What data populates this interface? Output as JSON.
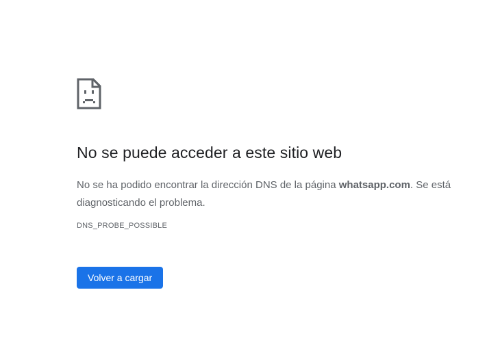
{
  "error_page": {
    "icon": "sad-page-icon",
    "headline": "No se puede acceder a este sitio web",
    "message_prefix": "No se ha podido encontrar la dirección DNS de la página ",
    "message_domain": "whatsapp.com",
    "message_suffix": ". Se está diagnosticando el problema.",
    "error_code": "DNS_PROBE_POSSIBLE",
    "reload_label": "Volver a cargar"
  },
  "colors": {
    "background": "#ffffff",
    "headline": "#202124",
    "body_text": "#5f6368",
    "button": "#1a73e8",
    "button_text": "#ffffff"
  }
}
